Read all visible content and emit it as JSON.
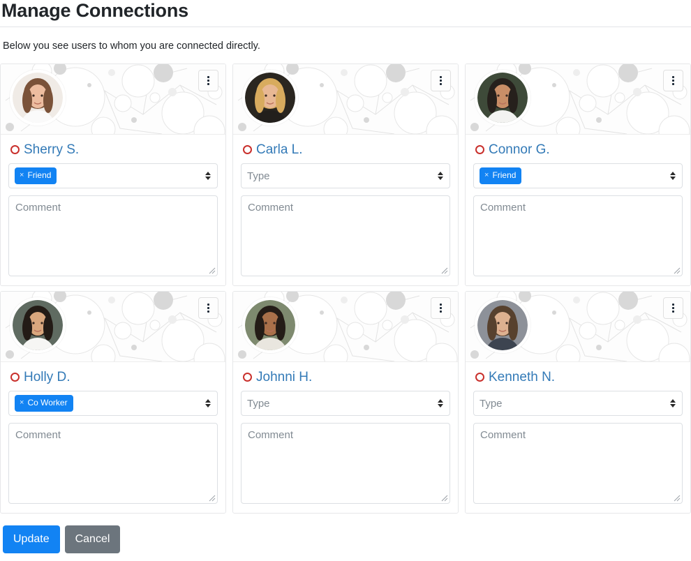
{
  "header": {
    "title": "Manage Connections",
    "intro": "Below you see users to whom you are connected directly."
  },
  "colors": {
    "accent_blue": "#1283f3",
    "link_blue": "#337ab7",
    "status_red": "#c9302c",
    "cancel_gray": "#6c757d",
    "tag_bg": "#1283f3"
  },
  "card_ui": {
    "type_placeholder": "Type",
    "comment_placeholder": "Comment",
    "menu_icon": "kebab-menu-icon",
    "status_icon": "circle-outline-icon"
  },
  "connections": [
    {
      "name": "Sherry S.",
      "tag": "Friend",
      "tag_remove": "×",
      "type_placeholder": "Type",
      "comment_placeholder": "Comment",
      "has_tag": true,
      "avatar": "avatar-sherry"
    },
    {
      "name": "Carla L.",
      "tag": "",
      "tag_remove": "",
      "type_placeholder": "Type",
      "comment_placeholder": "Comment",
      "has_tag": false,
      "avatar": "avatar-carla"
    },
    {
      "name": "Connor G.",
      "tag": "Friend",
      "tag_remove": "×",
      "type_placeholder": "Type",
      "comment_placeholder": "Comment",
      "has_tag": true,
      "avatar": "avatar-connor"
    },
    {
      "name": "Holly D.",
      "tag": "Co Worker",
      "tag_remove": "×",
      "type_placeholder": "Type",
      "comment_placeholder": "Comment",
      "has_tag": true,
      "avatar": "avatar-holly"
    },
    {
      "name": "Johnni H.",
      "tag": "",
      "tag_remove": "",
      "type_placeholder": "Type",
      "comment_placeholder": "Comment",
      "has_tag": false,
      "avatar": "avatar-johnni"
    },
    {
      "name": "Kenneth N.",
      "tag": "",
      "tag_remove": "",
      "type_placeholder": "Type",
      "comment_placeholder": "Comment",
      "has_tag": false,
      "avatar": "avatar-kenneth"
    }
  ],
  "footer": {
    "update_label": "Update",
    "cancel_label": "Cancel"
  }
}
